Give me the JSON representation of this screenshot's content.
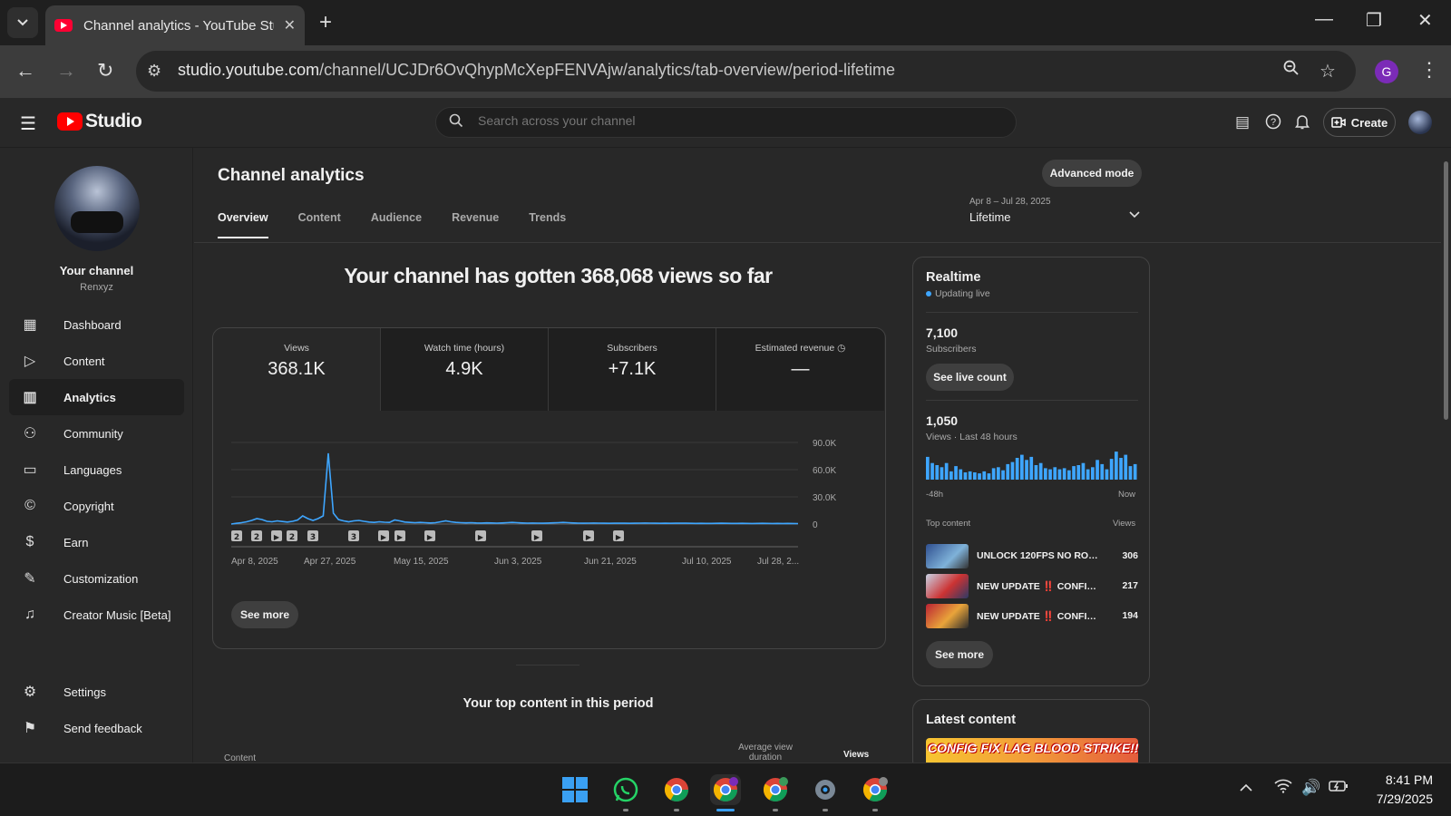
{
  "browser": {
    "tab_title": "Channel analytics - YouTube Studio",
    "url_host": "studio.youtube.com",
    "url_path": "/channel/UCJDr6OvQhypMcXepFENVAjw/analytics/tab-overview/period-lifetime",
    "profile_initial": "G"
  },
  "header": {
    "logo_text": "Studio",
    "search_placeholder": "Search across your channel",
    "create_label": "Create"
  },
  "sidebar": {
    "channel_title": "Your channel",
    "channel_handle": "Renxyz",
    "items": [
      {
        "label": "Dashboard",
        "icon": "dashboard-icon"
      },
      {
        "label": "Content",
        "icon": "content-icon"
      },
      {
        "label": "Analytics",
        "icon": "analytics-icon",
        "active": true
      },
      {
        "label": "Community",
        "icon": "community-icon"
      },
      {
        "label": "Languages",
        "icon": "languages-icon"
      },
      {
        "label": "Copyright",
        "icon": "copyright-icon"
      },
      {
        "label": "Earn",
        "icon": "earn-icon"
      },
      {
        "label": "Customization",
        "icon": "customization-icon"
      },
      {
        "label": "Creator Music [Beta]",
        "icon": "music-icon"
      }
    ],
    "bottom": [
      {
        "label": "Settings",
        "icon": "settings-icon"
      },
      {
        "label": "Send feedback",
        "icon": "feedback-icon"
      }
    ]
  },
  "main": {
    "title": "Channel analytics",
    "advanced_mode": "Advanced mode",
    "tabs": [
      "Overview",
      "Content",
      "Audience",
      "Revenue",
      "Trends"
    ],
    "period_range": "Apr 8 – Jul 28, 2025",
    "period_label": "Lifetime",
    "headline": "Your channel has gotten 368,068 views so far",
    "metrics": [
      {
        "label": "Views",
        "value": "368.1K"
      },
      {
        "label": "Watch time (hours)",
        "value": "4.9K"
      },
      {
        "label": "Subscribers",
        "value": "+7.1K"
      },
      {
        "label": "Estimated revenue",
        "value": "—"
      }
    ],
    "see_more": "See more",
    "top_content_title": "Your top content in this period",
    "columns": {
      "content": "Content",
      "avg_duration": "Average view duration",
      "views": "Views"
    }
  },
  "chart_data": {
    "type": "line",
    "x_ticks": [
      "Apr 8, 2025",
      "Apr 27, 2025",
      "May 15, 2025",
      "Jun 3, 2025",
      "Jun 21, 2025",
      "Jul 10, 2025",
      "Jul 28, 2..."
    ],
    "y_ticks": [
      "90.0K",
      "60.0K",
      "30.0K",
      "0"
    ],
    "ylim": [
      0,
      90000
    ],
    "values": [
      0,
      800,
      1500,
      2500,
      4000,
      6000,
      5000,
      3000,
      2500,
      3500,
      2800,
      2200,
      3000,
      4500,
      9000,
      6000,
      4000,
      6000,
      9000,
      78000,
      12000,
      5000,
      3500,
      2500,
      3500,
      4000,
      3000,
      2200,
      1800,
      2500,
      2000,
      1800,
      4500,
      3500,
      2200,
      1800,
      1500,
      1800,
      1500,
      1200,
      1500,
      2500,
      3500,
      2500,
      1800,
      1500,
      1300,
      1500,
      1200,
      1100,
      1300,
      1200,
      1000,
      1200,
      1500,
      1800,
      1500,
      1200,
      1000,
      1100,
      1000,
      900,
      1100,
      1300,
      1500,
      1800,
      1500,
      1200,
      1000,
      900,
      1000,
      1100,
      1000,
      900,
      800,
      900,
      1000,
      900,
      800,
      900,
      1000,
      1100,
      1000,
      900,
      800,
      900,
      800,
      900,
      1000,
      900,
      800,
      700,
      800,
      700,
      700,
      800,
      900,
      800,
      700,
      700,
      800,
      700,
      600,
      700,
      800,
      700,
      600,
      700,
      600,
      700,
      600,
      500
    ],
    "markers": [
      "2",
      "2",
      "▶",
      "2",
      "3",
      "3",
      "▶",
      "▶",
      "▶",
      "▶",
      "▶",
      "▶",
      "▶"
    ]
  },
  "realtime": {
    "title": "Realtime",
    "status": "Updating live",
    "subscribers_value": "7,100",
    "subscribers_label": "Subscribers",
    "live_count_btn": "See live count",
    "views_value": "1,050",
    "views_label": "Views · Last 48 hours",
    "axis_start": "-48h",
    "axis_end": "Now",
    "bars": [
      22,
      16,
      14,
      12,
      16,
      8,
      13,
      10,
      7,
      8,
      7,
      6,
      8,
      6,
      11,
      12,
      9,
      15,
      17,
      21,
      24,
      19,
      22,
      14,
      16,
      11,
      10,
      12,
      10,
      11,
      9,
      13,
      14,
      16,
      10,
      12,
      19,
      15,
      10,
      20,
      27,
      21,
      24,
      13,
      15
    ],
    "top_content_label": "Top content",
    "views_col": "Views",
    "top": [
      {
        "title": "UNLOCK 120FPS NO ROOT...",
        "views": "306"
      },
      {
        "title": "NEW UPDATE ‼️ CONFIG FI...",
        "views": "217"
      },
      {
        "title": "NEW UPDATE ‼️ CONFIG FI...",
        "views": "194"
      }
    ],
    "see_more": "See more"
  },
  "latest": {
    "title": "Latest content",
    "thumb_text": "CONFIG FIX LAG BLOOD STRIKE!!"
  },
  "taskbar": {
    "time": "8:41 PM",
    "date": "7/29/2025"
  }
}
